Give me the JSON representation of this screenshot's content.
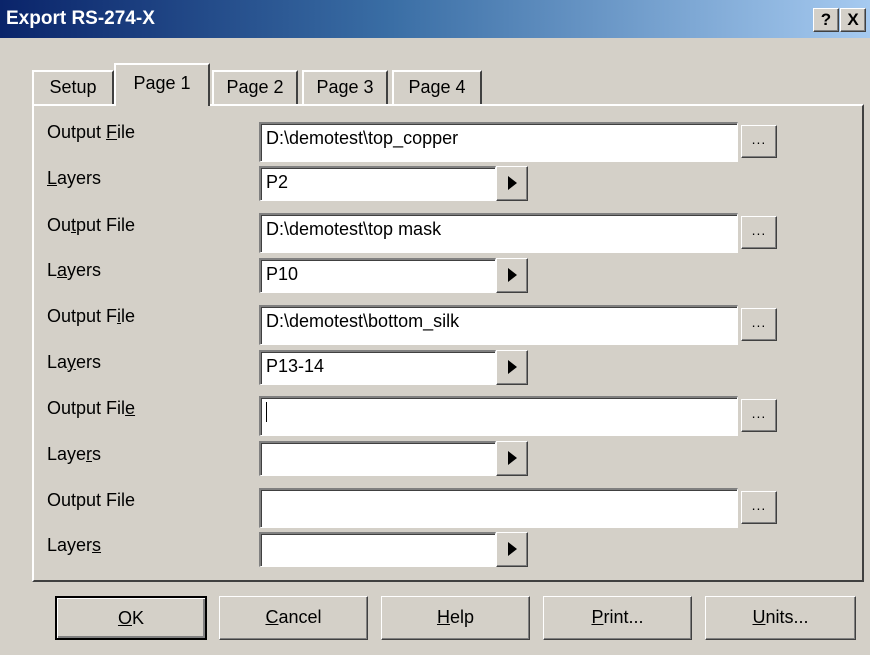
{
  "window": {
    "title": "Export RS-274-X",
    "help_button": "?",
    "close_button": "X"
  },
  "tabs": [
    {
      "label": "Setup",
      "active": false
    },
    {
      "label": "Page 1",
      "active": true
    },
    {
      "label": "Page 2",
      "active": false
    },
    {
      "label": "Page 3",
      "active": false
    },
    {
      "label": "Page 4",
      "active": false
    }
  ],
  "rows": [
    {
      "output_label_pre": "Output ",
      "output_label_key": "F",
      "output_label_post": "ile",
      "output_value": "D:\\demotest\\top_copper",
      "layers_label_pre": "",
      "layers_label_key": "L",
      "layers_label_post": "ayers",
      "layers_value": "P2"
    },
    {
      "output_label_pre": "Ou",
      "output_label_key": "t",
      "output_label_post": "put File",
      "output_value": "D:\\demotest\\top mask",
      "layers_label_pre": "L",
      "layers_label_key": "a",
      "layers_label_post": "yers",
      "layers_value": "P10"
    },
    {
      "output_label_pre": "Output F",
      "output_label_key": "i",
      "output_label_post": "le",
      "output_value": "D:\\demotest\\bottom_silk",
      "layers_label_pre": "La",
      "layers_label_key": "y",
      "layers_label_post": "ers",
      "layers_value": "P13-14"
    },
    {
      "output_label_pre": "Output Fil",
      "output_label_key": "e",
      "output_label_post": "",
      "output_value": "",
      "layers_label_pre": "Laye",
      "layers_label_key": "r",
      "layers_label_post": "s",
      "layers_value": ""
    },
    {
      "output_label_pre": "Output File",
      "output_label_key": "",
      "output_label_post": "",
      "output_value": "",
      "layers_label_pre": "Layer",
      "layers_label_key": "s",
      "layers_label_post": "",
      "layers_value": ""
    }
  ],
  "browse_label": "...",
  "buttons": [
    {
      "key": "O",
      "rest": "K"
    },
    {
      "key": "C",
      "rest": "ancel"
    },
    {
      "key": "H",
      "rest": "elp"
    },
    {
      "key": "P",
      "rest": "rint..."
    },
    {
      "key": "U",
      "rest": "nits..."
    }
  ]
}
